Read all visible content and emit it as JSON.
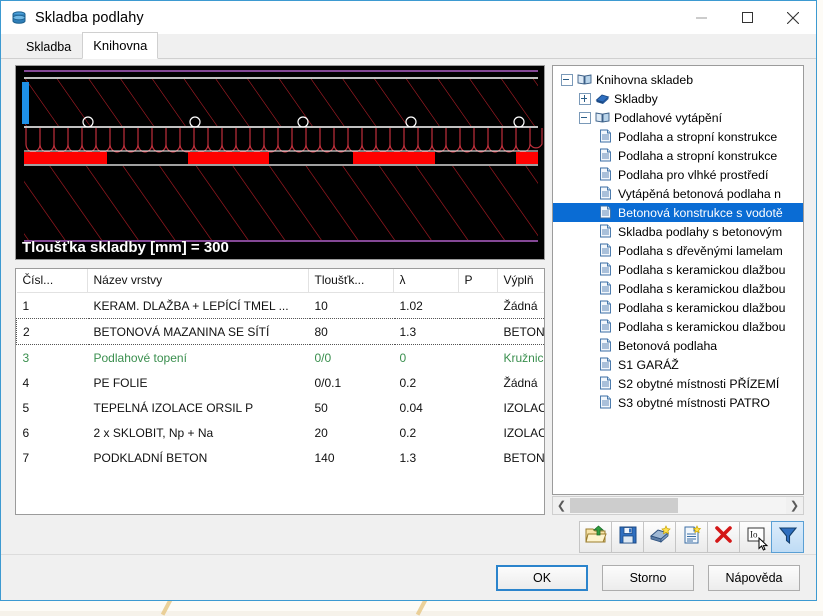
{
  "window": {
    "title": "Skladba podlahy",
    "app_icon": "database-icon",
    "minimize_label": "—",
    "maximize_label": "□",
    "close_label": "✕"
  },
  "tabs": [
    {
      "label": "Skladba",
      "active": false
    },
    {
      "label": "Knihovna",
      "active": true
    }
  ],
  "preview": {
    "thickness_label": "Tloušťka skladby [mm] = 300",
    "background": "#000000",
    "hatch_color": "#c0202a",
    "line_color": "#ffffff",
    "band_color": "#ff0000",
    "border_color": "#b060c8",
    "marker_color": "#4da3ff"
  },
  "table": {
    "columns": [
      {
        "key": "num",
        "label": "Čísl..."
      },
      {
        "key": "name",
        "label": "Název vrstvy"
      },
      {
        "key": "thick",
        "label": "Tloušťk..."
      },
      {
        "key": "lam",
        "label": "λ"
      },
      {
        "key": "p",
        "label": "P"
      },
      {
        "key": "fill",
        "label": "Výplň"
      }
    ],
    "rows": [
      {
        "num": "1",
        "name": "KERAM. DLAŽBA + LEPÍCÍ TMEL ...",
        "thick": "10",
        "lam": "1.02",
        "p": "",
        "fill": "Žádná",
        "state": "normal"
      },
      {
        "num": "2",
        "name": "BETONOVÁ MAZANINA SE SÍTÍ",
        "thick": "80",
        "lam": "1.3",
        "p": "",
        "fill": "BETON-ZELEZO...",
        "state": "focused"
      },
      {
        "num": "3",
        "name": "Podlahové topení",
        "thick": "0/0",
        "lam": "0",
        "p": "",
        "fill": "Kružnice",
        "state": "green"
      },
      {
        "num": "4",
        "name": "PE FOLIE",
        "thick": "0/0.1",
        "lam": "0.2",
        "p": "",
        "fill": "Žádná",
        "state": "normal"
      },
      {
        "num": "5",
        "name": "TEPELNÁ IZOLACE ORSIL P",
        "thick": "50",
        "lam": "0.04",
        "p": "",
        "fill": "IZOLACE_TEPEL...",
        "state": "normal"
      },
      {
        "num": "6",
        "name": "2 x SKLOBIT, Np + Na",
        "thick": "20",
        "lam": "0.2",
        "p": "",
        "fill": "IZOLACE_VODO...",
        "state": "normal"
      },
      {
        "num": "7",
        "name": "PODKLADNÍ BETON",
        "thick": "140",
        "lam": "1.3",
        "p": "",
        "fill": "BETON-PROSTY",
        "state": "normal"
      }
    ]
  },
  "tree": {
    "nodes": [
      {
        "label": "Knihovna skladeb",
        "level": 0,
        "icon": "book-open-icon",
        "expander": "minus",
        "selected": false
      },
      {
        "label": "Skladby",
        "level": 1,
        "icon": "book-blue-icon",
        "expander": "plus",
        "selected": false
      },
      {
        "label": "Podlahové vytápění",
        "level": 1,
        "icon": "book-open-icon",
        "expander": "minus",
        "selected": false
      },
      {
        "label": "Podlaha a stropní konstrukce ",
        "level": 2,
        "icon": "document-icon",
        "expander": "none",
        "selected": false
      },
      {
        "label": "Podlaha a stropní konstrukce ",
        "level": 2,
        "icon": "document-icon",
        "expander": "none",
        "selected": false
      },
      {
        "label": "Podlaha pro vlhké prostředí",
        "level": 2,
        "icon": "document-icon",
        "expander": "none",
        "selected": false
      },
      {
        "label": "Vytápěná betonová podlaha n",
        "level": 2,
        "icon": "document-icon",
        "expander": "none",
        "selected": false
      },
      {
        "label": "Betonová konstrukce s vodotě",
        "level": 2,
        "icon": "document-icon",
        "expander": "none",
        "selected": true
      },
      {
        "label": "Skladba podlahy s betonovým",
        "level": 2,
        "icon": "document-icon",
        "expander": "none",
        "selected": false
      },
      {
        "label": "Podlaha s dřevěnými lamelam",
        "level": 2,
        "icon": "document-icon",
        "expander": "none",
        "selected": false
      },
      {
        "label": "Podlaha s keramickou dlažbou",
        "level": 2,
        "icon": "document-icon",
        "expander": "none",
        "selected": false
      },
      {
        "label": "Podlaha s keramickou dlažbou",
        "level": 2,
        "icon": "document-icon",
        "expander": "none",
        "selected": false
      },
      {
        "label": "Podlaha s keramickou dlažbou",
        "level": 2,
        "icon": "document-icon",
        "expander": "none",
        "selected": false
      },
      {
        "label": "Podlaha s keramickou dlažbou",
        "level": 2,
        "icon": "document-icon",
        "expander": "none",
        "selected": false
      },
      {
        "label": "Betonová podlaha",
        "level": 2,
        "icon": "document-icon",
        "expander": "none",
        "selected": false
      },
      {
        "label": "S1 GARÁŽ",
        "level": 2,
        "icon": "document-icon",
        "expander": "none",
        "selected": false
      },
      {
        "label": "S2 obytné místnosti PŘÍZEMÍ",
        "level": 2,
        "icon": "document-icon",
        "expander": "none",
        "selected": false
      },
      {
        "label": "S3 obytné místnosti PATRO",
        "level": 2,
        "icon": "document-icon",
        "expander": "none",
        "selected": false
      }
    ],
    "hscroll": {
      "left_arrow": "❮",
      "right_arrow": "❯"
    }
  },
  "toolbar": {
    "buttons": [
      {
        "name": "open-library-button",
        "icon": "folder-open-icon",
        "active": false
      },
      {
        "name": "save-library-button",
        "icon": "floppy-save-icon",
        "active": false
      },
      {
        "name": "new-library-button",
        "icon": "book-new-icon",
        "active": false
      },
      {
        "name": "new-item-button",
        "icon": "document-new-icon",
        "active": false
      },
      {
        "name": "delete-item-button",
        "icon": "red-x-icon",
        "active": false
      },
      {
        "name": "rename-item-button",
        "icon": "rename-io-icon",
        "active": false
      },
      {
        "name": "filter-button",
        "icon": "funnel-filter-icon",
        "active": true
      }
    ]
  },
  "footer": {
    "ok_label": "OK",
    "cancel_label": "Storno",
    "help_label": "Nápověda"
  },
  "colors": {
    "accent": "#0a6cd4",
    "window_border": "#3d9ad1",
    "green_row": "#3a8f4e",
    "red": "#ff0000"
  }
}
